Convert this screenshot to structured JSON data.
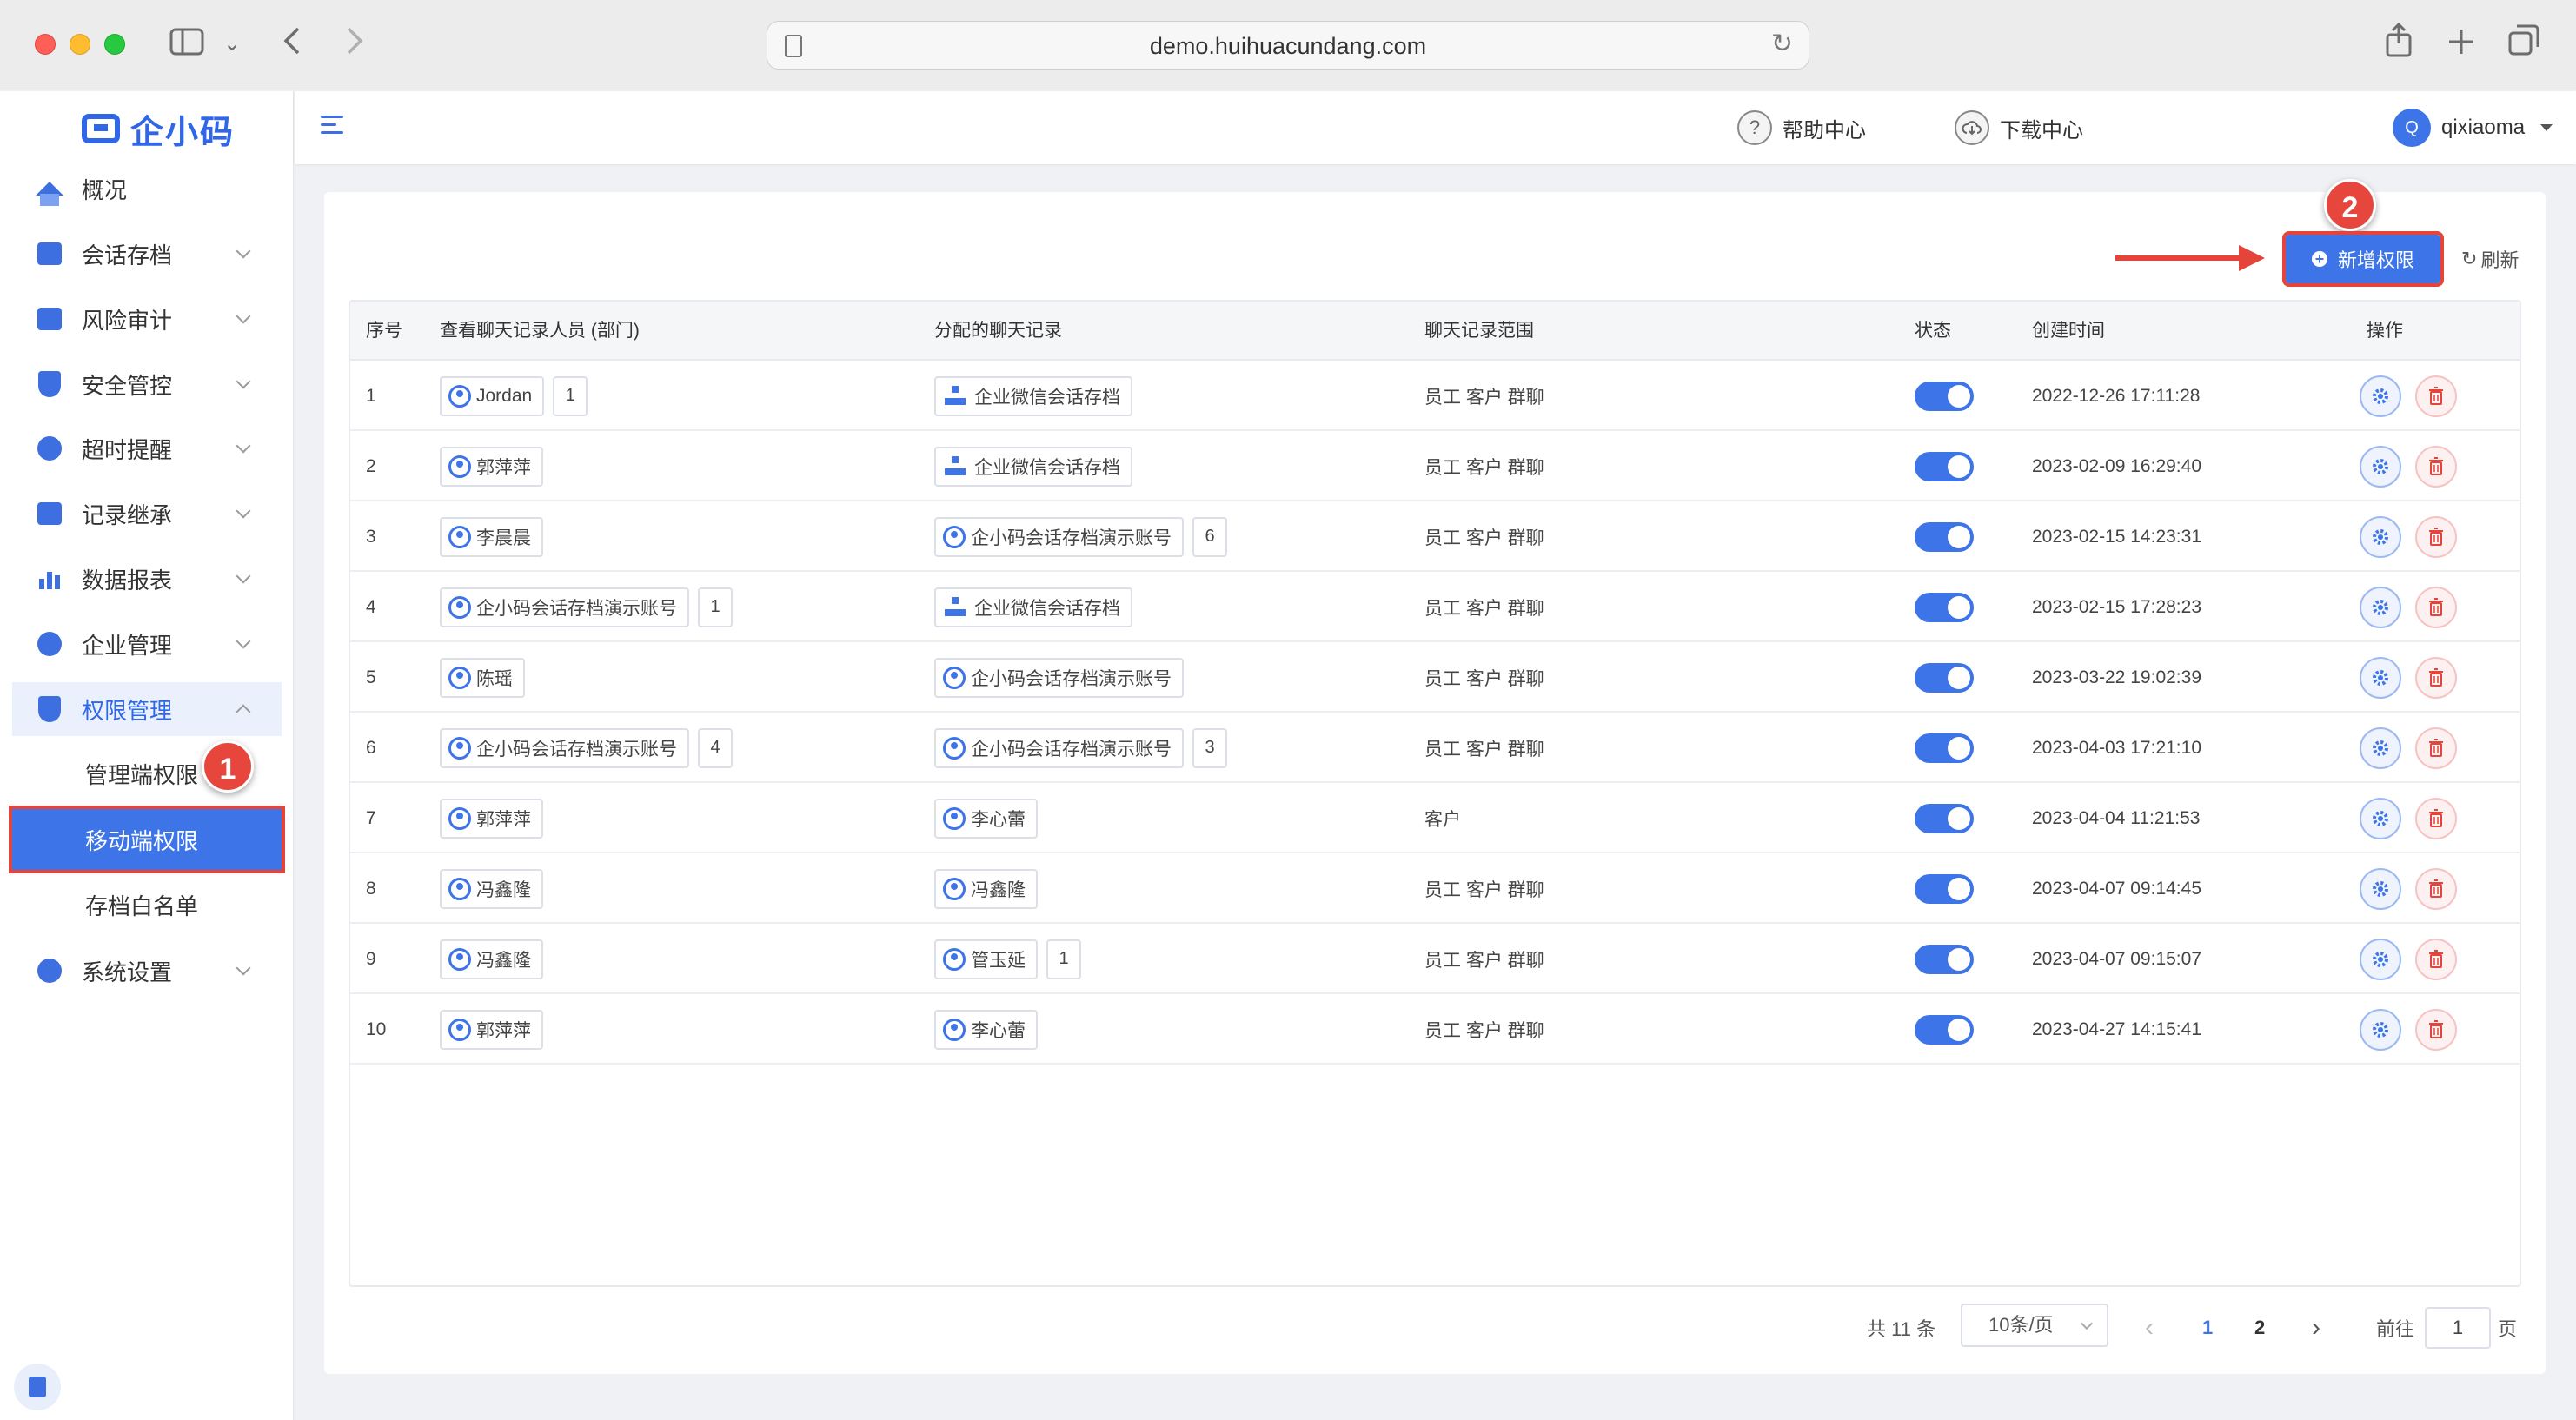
{
  "browser": {
    "url": "demo.huihuacundang.com"
  },
  "logo": {
    "text": "企小码"
  },
  "sidebar": {
    "items": [
      {
        "label": "概况",
        "icon": "home-icon"
      },
      {
        "label": "会话存档",
        "icon": "folder-icon"
      },
      {
        "label": "风险审计",
        "icon": "audit-icon"
      },
      {
        "label": "安全管控",
        "icon": "shield-icon"
      },
      {
        "label": "超时提醒",
        "icon": "bell-icon"
      },
      {
        "label": "记录继承",
        "icon": "record-icon"
      },
      {
        "label": "数据报表",
        "icon": "chart-icon"
      },
      {
        "label": "企业管理",
        "icon": "enterprise-icon"
      },
      {
        "label": "权限管理",
        "icon": "permission-icon"
      },
      {
        "label": "系统设置",
        "icon": "gear-icon"
      }
    ],
    "sub_items": [
      {
        "label": "管理端权限"
      },
      {
        "label": "移动端权限"
      },
      {
        "label": "存档白名单"
      }
    ]
  },
  "annotations": {
    "step1": "1",
    "step2": "2"
  },
  "header": {
    "help": "帮助中心",
    "help_icon": "?",
    "download": "下载中心",
    "avatar_letter": "Q",
    "username": "qixiaoma"
  },
  "toolbar": {
    "add_label": "新增权限",
    "add_icon": "+",
    "refresh_label": "刷新",
    "refresh_icon": "↻"
  },
  "table": {
    "headers": [
      "序号",
      "查看聊天记录人员 (部门)",
      "分配的聊天记录",
      "聊天记录范围",
      "状态",
      "创建时间",
      "操作"
    ],
    "rows": [
      {
        "no": "1",
        "viewer": "Jordan",
        "viewer_type": "user",
        "viewer_count": "1",
        "assigned": "企业微信会话存档",
        "assigned_type": "org",
        "assigned_count": "",
        "scope": "员工  客户  群聊",
        "time": "2022-12-26 17:11:28"
      },
      {
        "no": "2",
        "viewer": "郭萍萍",
        "viewer_type": "user",
        "viewer_count": "",
        "assigned": "企业微信会话存档",
        "assigned_type": "org",
        "assigned_count": "",
        "scope": "员工  客户  群聊",
        "time": "2023-02-09 16:29:40"
      },
      {
        "no": "3",
        "viewer": "李晨晨",
        "viewer_type": "user",
        "viewer_count": "",
        "assigned": "企小码会话存档演示账号",
        "assigned_type": "user",
        "assigned_count": "6",
        "scope": "员工  客户  群聊",
        "time": "2023-02-15 14:23:31"
      },
      {
        "no": "4",
        "viewer": "企小码会话存档演示账号",
        "viewer_type": "user",
        "viewer_count": "1",
        "assigned": "企业微信会话存档",
        "assigned_type": "org",
        "assigned_count": "",
        "scope": "员工  客户  群聊",
        "time": "2023-02-15 17:28:23"
      },
      {
        "no": "5",
        "viewer": "陈瑶",
        "viewer_type": "user",
        "viewer_count": "",
        "assigned": "企小码会话存档演示账号",
        "assigned_type": "user",
        "assigned_count": "",
        "scope": "员工  客户  群聊",
        "time": "2023-03-22 19:02:39"
      },
      {
        "no": "6",
        "viewer": "企小码会话存档演示账号",
        "viewer_type": "user",
        "viewer_count": "4",
        "assigned": "企小码会话存档演示账号",
        "assigned_type": "user",
        "assigned_count": "3",
        "scope": "员工  客户  群聊",
        "time": "2023-04-03 17:21:10"
      },
      {
        "no": "7",
        "viewer": "郭萍萍",
        "viewer_type": "user",
        "viewer_count": "",
        "assigned": "李心蕾",
        "assigned_type": "user",
        "assigned_count": "",
        "scope": "客户",
        "time": "2023-04-04 11:21:53"
      },
      {
        "no": "8",
        "viewer": "冯鑫隆",
        "viewer_type": "user",
        "viewer_count": "",
        "assigned": "冯鑫隆",
        "assigned_type": "user",
        "assigned_count": "",
        "scope": "员工  客户  群聊",
        "time": "2023-04-07 09:14:45"
      },
      {
        "no": "9",
        "viewer": "冯鑫隆",
        "viewer_type": "user",
        "viewer_count": "",
        "assigned": "管玉延",
        "assigned_type": "user",
        "assigned_count": "1",
        "scope": "员工  客户  群聊",
        "time": "2023-04-07 09:15:07"
      },
      {
        "no": "10",
        "viewer": "郭萍萍",
        "viewer_type": "user",
        "viewer_count": "",
        "assigned": "李心蕾",
        "assigned_type": "user",
        "assigned_count": "",
        "scope": "员工  客户  群聊",
        "time": "2023-04-27 14:15:41"
      }
    ]
  },
  "pagination": {
    "total": "共 11 条",
    "page_size": "10条/页",
    "prev": "‹",
    "next": "›",
    "pages": [
      "1",
      "2"
    ],
    "current": "1",
    "goto_prefix": "前往",
    "goto_value": "1",
    "goto_suffix": "页"
  },
  "colors": {
    "accent": "#3d74e8",
    "annotation": "#e5443a"
  }
}
